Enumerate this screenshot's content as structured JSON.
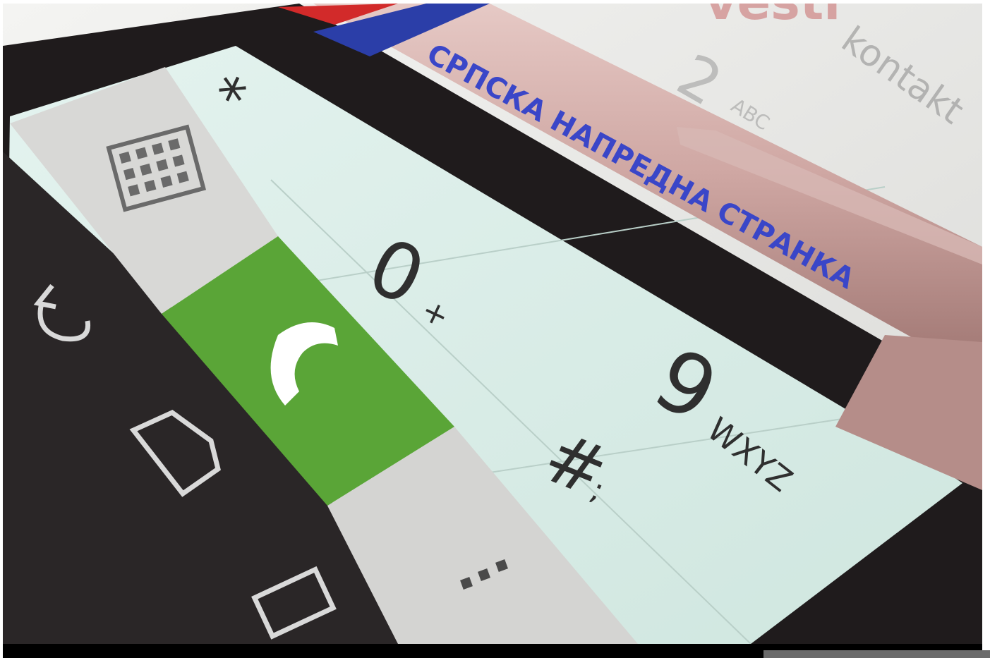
{
  "photo": {
    "description_icon": "phone-dialpad-photo",
    "pen_text": "СРПСКА НАПРЕДНА СТРАНКА",
    "background_text_brand": "vesti",
    "background_text_contact": "kontakt",
    "keys": {
      "key_0": "0",
      "key_0_sub": "+",
      "key_9": "9",
      "key_9_sub": "WXYZ",
      "key_hash": "#",
      "key_hash_sub": ";",
      "key_star": "*",
      "key_2": "2",
      "key_2_sub": "ABC"
    },
    "colors": {
      "call_green": "#5aa537",
      "screen_mint": "#dcefe9",
      "pen_pink": "#cfa7a3",
      "pen_text_blue": "#3a46c8",
      "flag_blue": "#2b3ea8",
      "flag_red": "#d22a2a"
    }
  }
}
